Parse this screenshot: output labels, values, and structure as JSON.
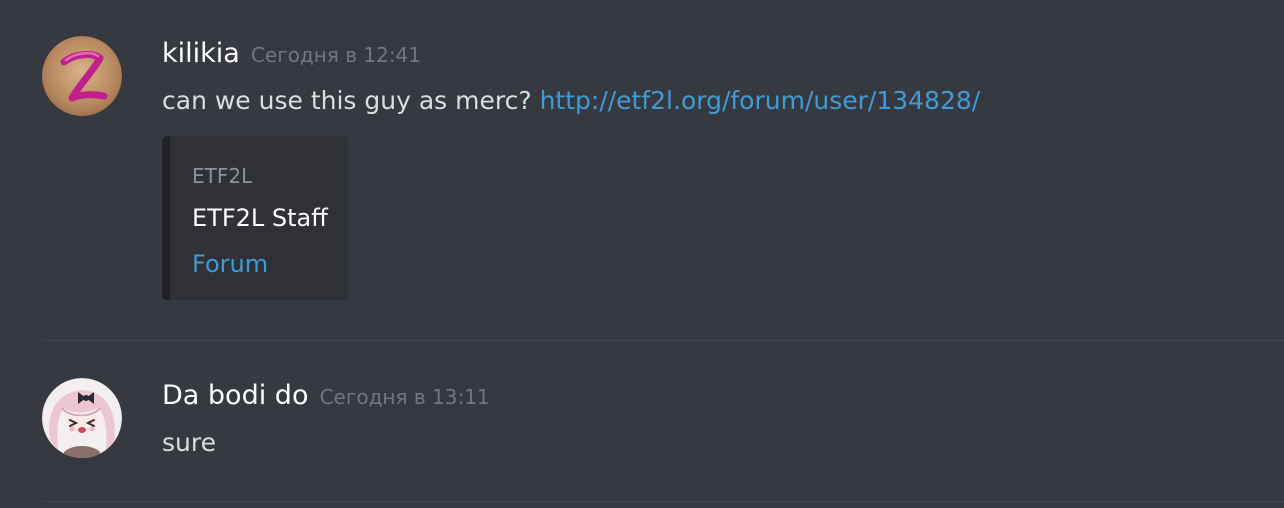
{
  "messages": [
    {
      "author": "kilikia",
      "timestamp": "Сегодня в 12:41",
      "text": "can we use this guy as merc? ",
      "link": "http://etf2l.org/forum/user/134828/",
      "embed": {
        "provider": "ETF2L",
        "title": "ETF2L Staff",
        "link_label": "Forum"
      }
    },
    {
      "author": "Da bodi do",
      "timestamp": "Сегодня в 13:11",
      "text": "sure"
    }
  ],
  "colors": {
    "background": "#36393f",
    "link": "#3f9bd6",
    "timestamp": "#72767d",
    "embed_background": "#2f3136"
  },
  "icons": {
    "avatar1": "pink-letter-z-avatar-icon",
    "avatar2": "anime-girl-avatar-icon"
  }
}
